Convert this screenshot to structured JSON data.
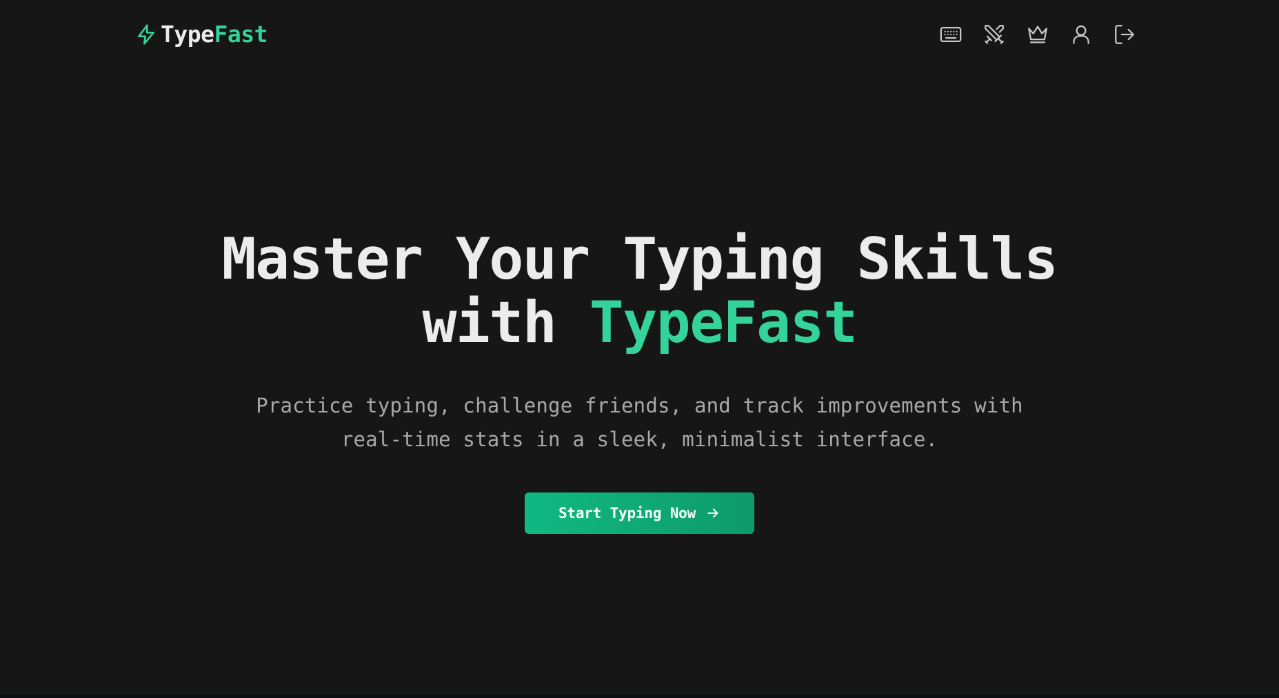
{
  "header": {
    "logo": {
      "part1": "Type",
      "part2": "Fast",
      "icon": "lightning-bolt-icon"
    },
    "nav_icons": [
      {
        "icon": "keyboard-icon"
      },
      {
        "icon": "crossed-swords-icon"
      },
      {
        "icon": "crown-icon"
      },
      {
        "icon": "user-icon"
      },
      {
        "icon": "logout-icon"
      }
    ]
  },
  "hero": {
    "title_line1": "Master Your Typing Skills",
    "title_line2_prefix": "with ",
    "title_line2_accent": "TypeFast",
    "subtitle": "Practice typing, challenge friends, and track improvements with real-time stats in a sleek, minimalist interface.",
    "cta_label": "Start Typing Now",
    "cta_icon": "arrow-right-icon"
  },
  "colors": {
    "background": "#161616",
    "accent": "#34d399",
    "button": "#10b981",
    "text": "#ececec",
    "muted": "#a8a8a8"
  }
}
